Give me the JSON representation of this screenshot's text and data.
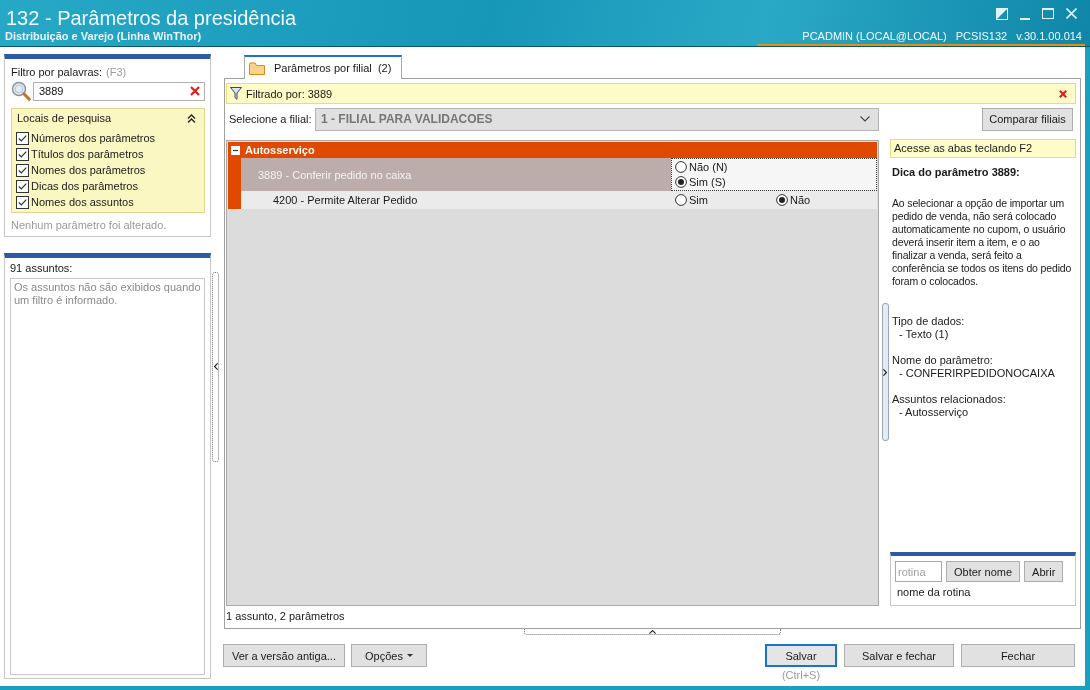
{
  "window": {
    "title": "132 - Parâmetros da presidência",
    "subtitle": "Distribuição e Varejo (Linha WinThor)",
    "user": "PCADMIN (LOCAL@LOCAL)",
    "module": "PCSIS132",
    "version": "v.30.1.00.014"
  },
  "filter_panel": {
    "label": "Filtro por palavras:",
    "shortcut": "(F3)",
    "search": {
      "value": "3889"
    },
    "locations": {
      "title": "Locais de pesquisa",
      "expanded": true,
      "options": [
        {
          "label": "Números dos parâmetros",
          "checked": true
        },
        {
          "label": "Títulos dos parâmetros",
          "checked": true
        },
        {
          "label": "Nomes dos parâmetros",
          "checked": true
        },
        {
          "label": "Dicas dos parâmetros",
          "checked": true
        },
        {
          "label": "Nomes dos assuntos",
          "checked": true
        }
      ]
    },
    "status": "Nenhum parâmetro foi alterado."
  },
  "subjects_panel": {
    "label": "91 assuntos:",
    "message": "Os assuntos não são exibidos quando um filtro é informado."
  },
  "tabs": [
    {
      "label": "Parâmetros por filial  (2)",
      "selected": true
    }
  ],
  "filter_bar": {
    "text": "Filtrado por: 3889"
  },
  "branch": {
    "label": "Selecione a filial:",
    "value": "1 - FILIAL PARA VALIDACOES",
    "disabled": true
  },
  "compare_button": "Comparar filiais",
  "groups": [
    {
      "name": "Autosserviço",
      "expanded": true,
      "parameters": [
        {
          "label": "3889 - Conferir pedido no caixa",
          "selected": true,
          "options": [
            {
              "label": "Não (N)",
              "selected": false
            },
            {
              "label": "Sim (S)",
              "selected": true
            }
          ]
        },
        {
          "label": "4200 - Permite Alterar Pedido",
          "selected": false,
          "options": [
            {
              "label": "Sim",
              "selected": false
            },
            {
              "label": "Não",
              "selected": true
            }
          ]
        }
      ]
    }
  ],
  "summary": "1 assunto, 2 parâmetros",
  "hint_panel": {
    "notice": "Acesse as abas teclando F2",
    "title": "Dica do parâmetro 3889:",
    "description": "Ao selecionar a opção de importar um pedido de venda, não será colocado automaticamente no cupom, o usuário deverá inserir item a item, e o ao finalizar a venda, será feito a conferência se todos os itens do pedido foram o colocados.",
    "details": [
      {
        "label": "Tipo de dados:",
        "value": "- Texto (1)"
      },
      {
        "label": "Nome do parâmetro:",
        "value": "- CONFERIRPEDIDONOCAIXA"
      },
      {
        "label": "Assuntos relacionados:",
        "value": "- Autosserviço"
      }
    ]
  },
  "routine_lookup": {
    "placeholder": "rotina",
    "buttons": [
      "Obter nome",
      "Abrir"
    ],
    "result": "nome da rotina"
  },
  "footer": {
    "left_buttons": [
      {
        "label": "Ver a versão antiga...",
        "kind": "plain"
      },
      {
        "label": "Opções",
        "kind": "menu"
      }
    ],
    "right_buttons": [
      {
        "label": "Salvar",
        "focused": true,
        "hint": "(Ctrl+S)"
      },
      {
        "label": "Salvar e fechar",
        "focused": false
      },
      {
        "label": "Fechar",
        "focused": false
      }
    ]
  }
}
